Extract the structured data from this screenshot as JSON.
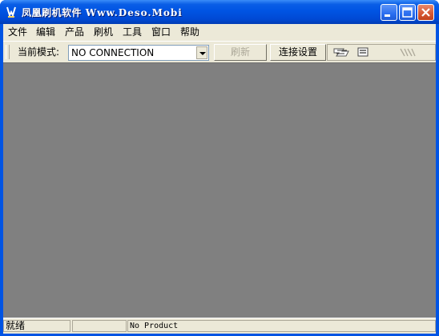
{
  "window": {
    "title_chinese": "凤凰刷机软件",
    "title_brand": "Www.Deso.Mobi",
    "icon": "app-logo-icon",
    "controls": [
      "minimize-icon",
      "maximize-icon",
      "close-icon"
    ],
    "colors": {
      "titlebar": "#0054e3",
      "close": "#d75a36",
      "face": "#ece9d8",
      "workspace": "#808080"
    }
  },
  "menu": {
    "items": [
      {
        "label": "文件"
      },
      {
        "label": "编辑"
      },
      {
        "label": "产品"
      },
      {
        "label": "刷机"
      },
      {
        "label": "工具"
      },
      {
        "label": "窗口"
      },
      {
        "label": "帮助"
      }
    ]
  },
  "toolbar": {
    "mode_label": "当前模式:",
    "mode_value": "NO CONNECTION",
    "refresh_label": "刷新",
    "connect_settings_label": "连接设置",
    "segment_icons": [
      "flash-phone-icon",
      "transfer-icon",
      "disabled-tool-icon"
    ]
  },
  "status": {
    "ready": "就绪",
    "middle": "",
    "product": "No Product"
  }
}
